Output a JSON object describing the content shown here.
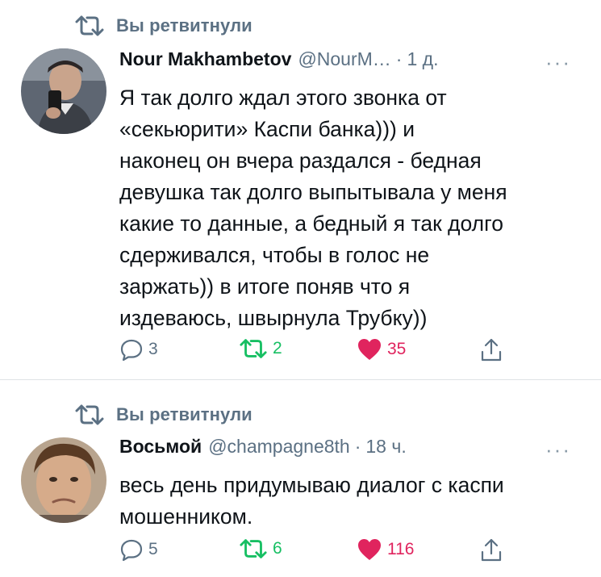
{
  "tweets": [
    {
      "retweet_label": "Вы ретвитнули",
      "author_name": "Nour Makhambetov",
      "author_handle": "@NourM…",
      "dot": "·",
      "time": "1 д.",
      "more": "···",
      "text": "Я так долго ждал этого звонка от\n«секьюрити» Каспи банка))) и\nнаконец он вчера раздался - бедная\nдевушка так долго выпытывала у меня\nкакие то данные, а бедный я так долго\nсдерживался, чтобы в голос не\nзаржать)) в итоге поняв что я\nиздеваюсь, швырнула Трубку))",
      "replies": "3",
      "retweets": "2",
      "likes": "35"
    },
    {
      "retweet_label": "Вы ретвитнули",
      "author_name": "Восьмой",
      "author_handle": "@champagne8th",
      "dot": "·",
      "time": "18 ч.",
      "more": "···",
      "text": "весь день придумываю диалог с каспи\nмошенником.",
      "replies": "5",
      "retweets": "6",
      "likes": "116"
    }
  ],
  "colors": {
    "secondary_text": "#5b7083",
    "retweet_green": "#17bf63",
    "like_red": "#e0245e",
    "divider": "#dfe3e6"
  },
  "icons": [
    "retweet-icon",
    "avatar-photo",
    "reply-icon",
    "heart-icon",
    "share-icon",
    "more-icon"
  ]
}
